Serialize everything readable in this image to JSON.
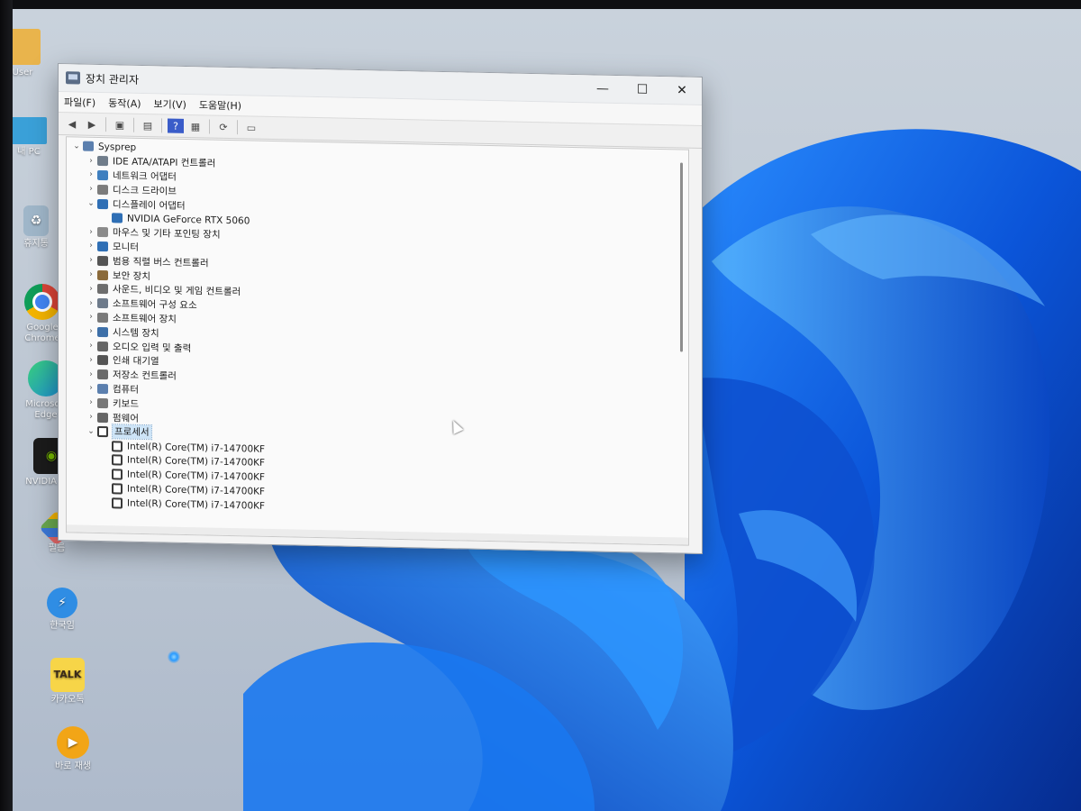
{
  "window": {
    "title": "장치 관리자",
    "controls": {
      "minimize": "—",
      "maximize": "☐",
      "close": "✕"
    }
  },
  "menu": [
    "파일(F)",
    "동작(A)",
    "보기(V)",
    "도움말(H)"
  ],
  "toolbar_icons": [
    "back-icon",
    "forward-icon",
    "properties-icon",
    "update-driver-icon",
    "help-icon",
    "view-icon",
    "scan-icon",
    "monitor-icon"
  ],
  "tree": [
    {
      "label": "Sysprep",
      "level": 0,
      "expanded": true,
      "icon": "computer-icon"
    },
    {
      "label": "IDE ATA/ATAPI 컨트롤러",
      "level": 1,
      "expanded": false,
      "icon": "ide-icon"
    },
    {
      "label": "네트워크 어댑터",
      "level": 1,
      "expanded": false,
      "icon": "network-icon"
    },
    {
      "label": "디스크 드라이브",
      "level": 1,
      "expanded": false,
      "icon": "disk-icon"
    },
    {
      "label": "디스플레이 어댑터",
      "level": 1,
      "expanded": true,
      "icon": "display-icon"
    },
    {
      "label": "NVIDIA GeForce RTX 5060",
      "level": 2,
      "icon": "display-icon"
    },
    {
      "label": "마우스 및 기타 포인팅 장치",
      "level": 1,
      "expanded": false,
      "icon": "mouse-icon"
    },
    {
      "label": "모니터",
      "level": 1,
      "expanded": false,
      "icon": "monitor-icon"
    },
    {
      "label": "범용 직렬 버스 컨트롤러",
      "level": 1,
      "expanded": false,
      "icon": "usb-icon"
    },
    {
      "label": "보안 장치",
      "level": 1,
      "expanded": false,
      "icon": "security-icon"
    },
    {
      "label": "사운드, 비디오 및 게임 컨트롤러",
      "level": 1,
      "expanded": false,
      "icon": "sound-icon"
    },
    {
      "label": "소프트웨어 구성 요소",
      "level": 1,
      "expanded": false,
      "icon": "software-component-icon"
    },
    {
      "label": "소프트웨어 장치",
      "level": 1,
      "expanded": false,
      "icon": "software-device-icon"
    },
    {
      "label": "시스템 장치",
      "level": 1,
      "expanded": false,
      "icon": "system-icon"
    },
    {
      "label": "오디오 입력 및 출력",
      "level": 1,
      "expanded": false,
      "icon": "audio-icon"
    },
    {
      "label": "인쇄 대기열",
      "level": 1,
      "expanded": false,
      "icon": "printer-icon"
    },
    {
      "label": "저장소 컨트롤러",
      "level": 1,
      "expanded": false,
      "icon": "storage-icon"
    },
    {
      "label": "컴퓨터",
      "level": 1,
      "expanded": false,
      "icon": "computer-icon"
    },
    {
      "label": "키보드",
      "level": 1,
      "expanded": false,
      "icon": "keyboard-icon"
    },
    {
      "label": "펌웨어",
      "level": 1,
      "expanded": false,
      "icon": "firmware-icon"
    },
    {
      "label": "프로세서",
      "level": 1,
      "expanded": true,
      "icon": "processor-icon",
      "selected": true
    },
    {
      "label": "Intel(R) Core(TM) i7-14700KF",
      "level": 2,
      "icon": "processor-icon"
    },
    {
      "label": "Intel(R) Core(TM) i7-14700KF",
      "level": 2,
      "icon": "processor-icon"
    },
    {
      "label": "Intel(R) Core(TM) i7-14700KF",
      "level": 2,
      "icon": "processor-icon"
    },
    {
      "label": "Intel(R) Core(TM) i7-14700KF",
      "level": 2,
      "icon": "processor-icon"
    },
    {
      "label": "Intel(R) Core(TM) i7-14700KF",
      "level": 2,
      "icon": "processor-icon"
    }
  ],
  "desktop_icons": [
    {
      "label": "User",
      "icon": "folder-icon",
      "color": "#e9b44c"
    },
    {
      "label": "내 PC",
      "icon": "this-pc-icon",
      "color": "#3aa0d8"
    },
    {
      "label": "휴지통",
      "icon": "recycle-bin-icon",
      "color": "#9fb6c9"
    },
    {
      "label": "Google Chrome",
      "icon": "chrome-icon",
      "color": "#db4437"
    },
    {
      "label": "Microsoft Edge",
      "icon": "edge-icon",
      "color": "#1d8fd6"
    },
    {
      "label": "NVIDIA App",
      "icon": "nvidia-icon",
      "color": "#1b1b1b"
    },
    {
      "label": "필름",
      "icon": "app-icon",
      "color": "#6aa84f"
    },
    {
      "label": "한국임",
      "icon": "bolt-app-icon",
      "color": "#2f8de4"
    },
    {
      "label": "카카오톡",
      "icon": "kakaotalk-icon",
      "color": "#f7d548"
    },
    {
      "label": "바로 재생",
      "icon": "player-icon",
      "color": "#f2a516"
    }
  ],
  "colors": {
    "accent": "#1d5fd6",
    "selection": "#cde4f7"
  }
}
